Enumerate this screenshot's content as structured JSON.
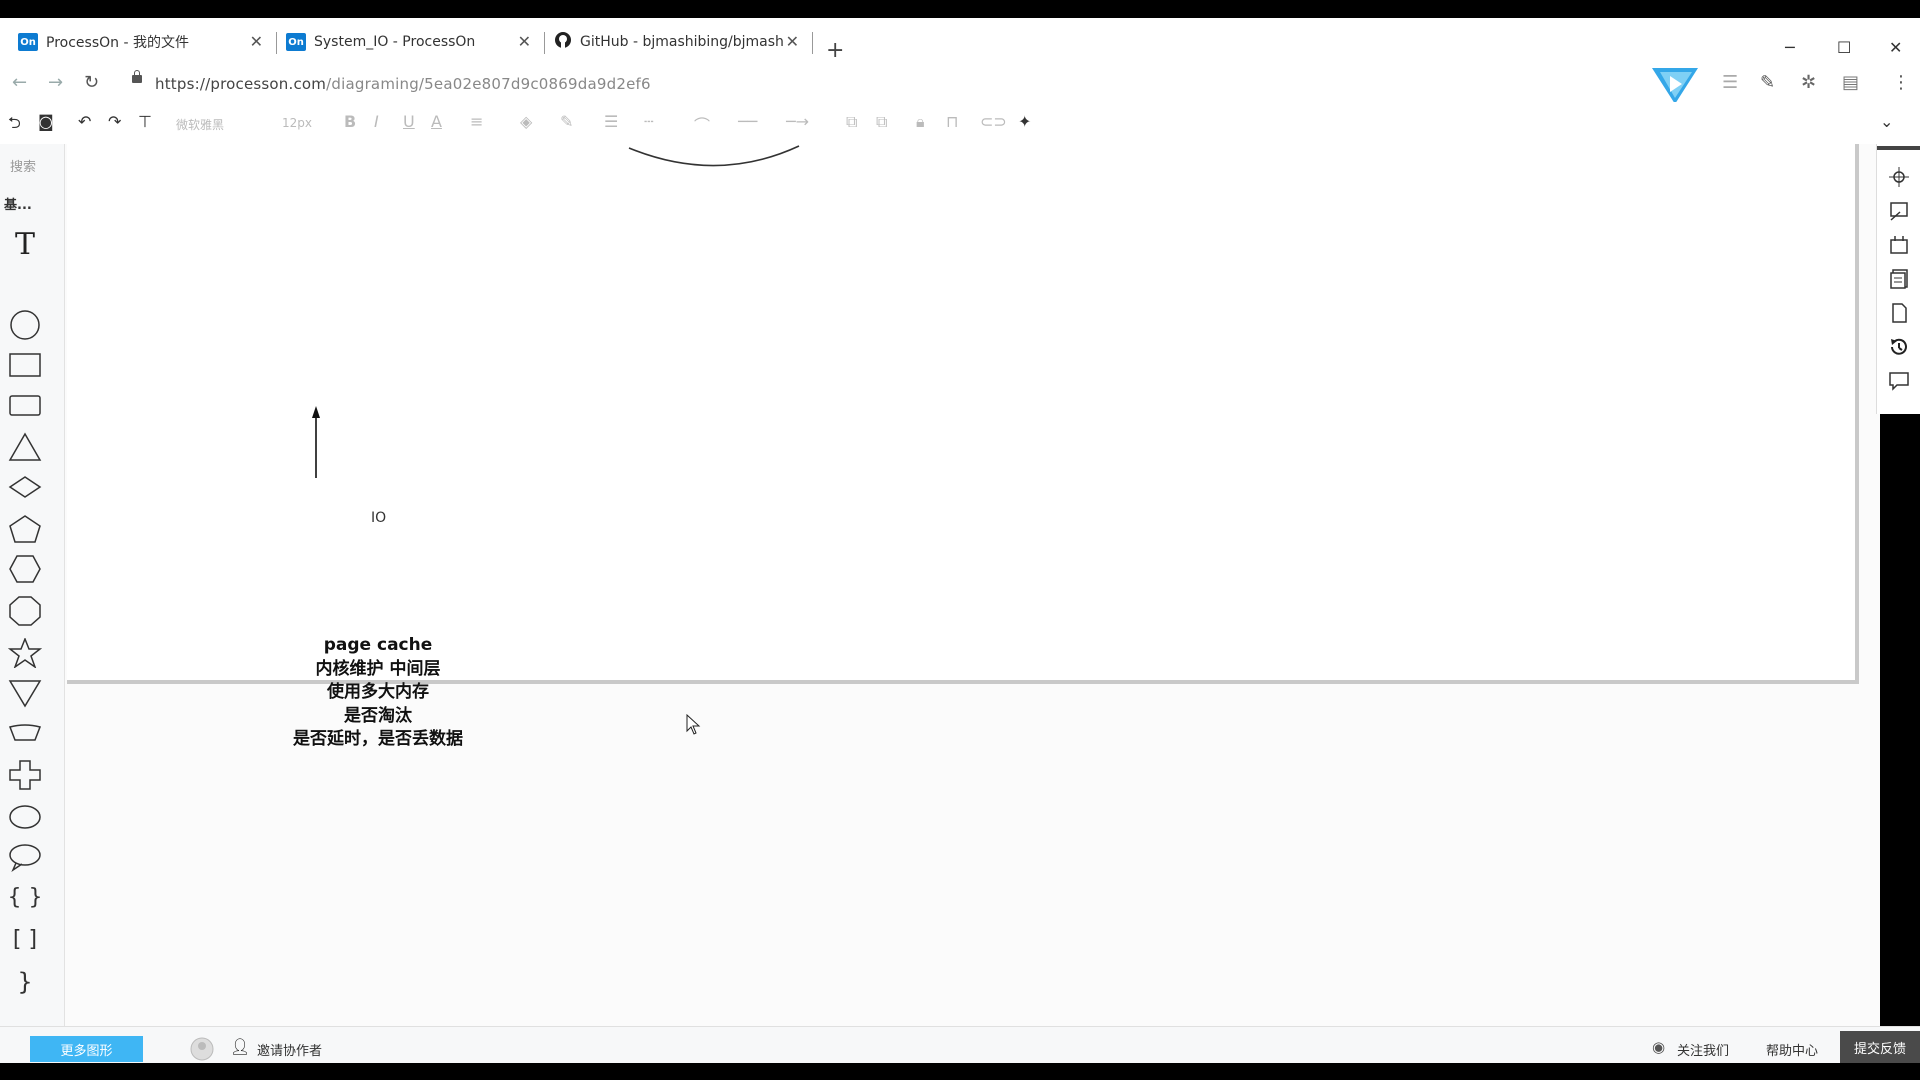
{
  "browser": {
    "tabs": [
      {
        "favicon": "On",
        "title": "ProcessOn - 我的文件"
      },
      {
        "favicon": "On",
        "title": "System_IO - ProcessOn"
      },
      {
        "favicon": "github-icon",
        "title": "GitHub - bjmashibing/bjmash"
      }
    ],
    "url_host": "https://processon.com",
    "url_path": "/diagraming/5ea02e807d9c0869da9d2ef6"
  },
  "toolbar": {
    "font_placeholder": "微软雅黑",
    "font_size": "12px"
  },
  "left_panel": {
    "search_label": "搜索",
    "category_label": "基..."
  },
  "diagram": {
    "io_label": "IO",
    "note_lines": [
      "page  cache",
      "内核维护  中间层",
      "使用多大内存",
      "是否淘汰",
      "是否延时，是否丢数据"
    ]
  },
  "status_bar": {
    "more_shapes": "更多图形",
    "invite": "邀请协作者",
    "follow_us": "关注我们",
    "help_center": "帮助中心",
    "feedback": "提交反馈"
  },
  "colors": {
    "accent": "#3fb6f4",
    "favicon": "#0d7bd1",
    "feedback_bg": "#4a4a4a"
  }
}
